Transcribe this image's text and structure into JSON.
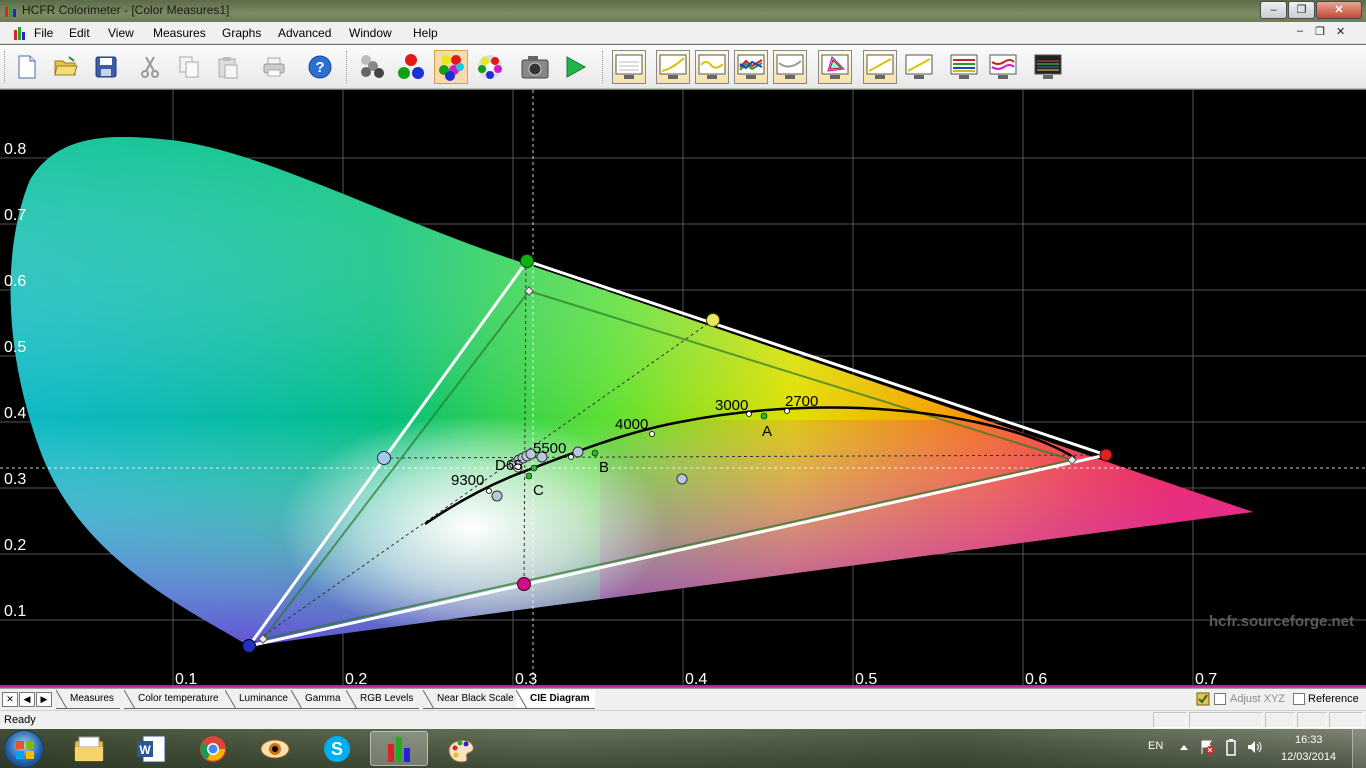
{
  "window": {
    "title": "HCFR Colorimeter - [Color Measures1]",
    "minimize": "–",
    "maximize": "❐",
    "close": "✕"
  },
  "menu": {
    "items": [
      "File",
      "Edit",
      "View",
      "Measures",
      "Graphs",
      "Advanced",
      "Window",
      "Help"
    ],
    "mdi_min": "–",
    "mdi_restore": "❐",
    "mdi_close": "✕"
  },
  "toolbar": {
    "buttons": [
      "new-document",
      "open-folder",
      "save",
      "cut",
      "copy",
      "paste",
      "print",
      "help",
      "measure-grayscale",
      "measure-primaries",
      "measure-saturations",
      "measure-all-colors",
      "camera",
      "play",
      "graph-screen-1",
      "graph-screen-2",
      "graph-screen-3",
      "graph-screen-4",
      "graph-screen-5",
      "graph-cie",
      "graph-screen-7",
      "graph-screen-8",
      "graph-screen-9",
      "graph-screen-10",
      "graph-screen-11"
    ]
  },
  "chart": {
    "y_ticks": [
      "0.8",
      "0.7",
      "0.6",
      "0.5",
      "0.4",
      "0.3",
      "0.2",
      "0.1"
    ],
    "x_ticks": [
      "0.1",
      "0.2",
      "0.3",
      "0.4",
      "0.5",
      "0.6",
      "0.7"
    ],
    "cct_labels": [
      "9300",
      "5500",
      "4000",
      "3000",
      "2700"
    ],
    "illuminant_labels": [
      "D65",
      "C",
      "B",
      "A"
    ],
    "watermark": "hcfr.sourceforge.net"
  },
  "tabs": {
    "items": [
      "Measures",
      "Color temperature",
      "Luminance",
      "Gamma",
      "RGB Levels",
      "Near Black Scale",
      "CIE Diagram"
    ],
    "active": "CIE Diagram",
    "adjust_xyz": "Adjust XYZ",
    "reference": "Reference"
  },
  "status": {
    "text": "Ready"
  },
  "taskbar": {
    "apps": [
      "file-explorer",
      "microsoft-word",
      "google-chrome",
      "eye-app",
      "skype",
      "hcfr-colorimeter",
      "paint"
    ],
    "language": "EN",
    "time": "16:33",
    "date": "12/03/2014"
  },
  "colors": {
    "white_line": "#ffffff",
    "red_point": "#e0201c",
    "green_point": "#10b010",
    "blue_point": "#2030c0",
    "magenta_point": "#d0108a",
    "yellow_point": "#e8e860",
    "cyan_point": "#a8c8e8"
  }
}
